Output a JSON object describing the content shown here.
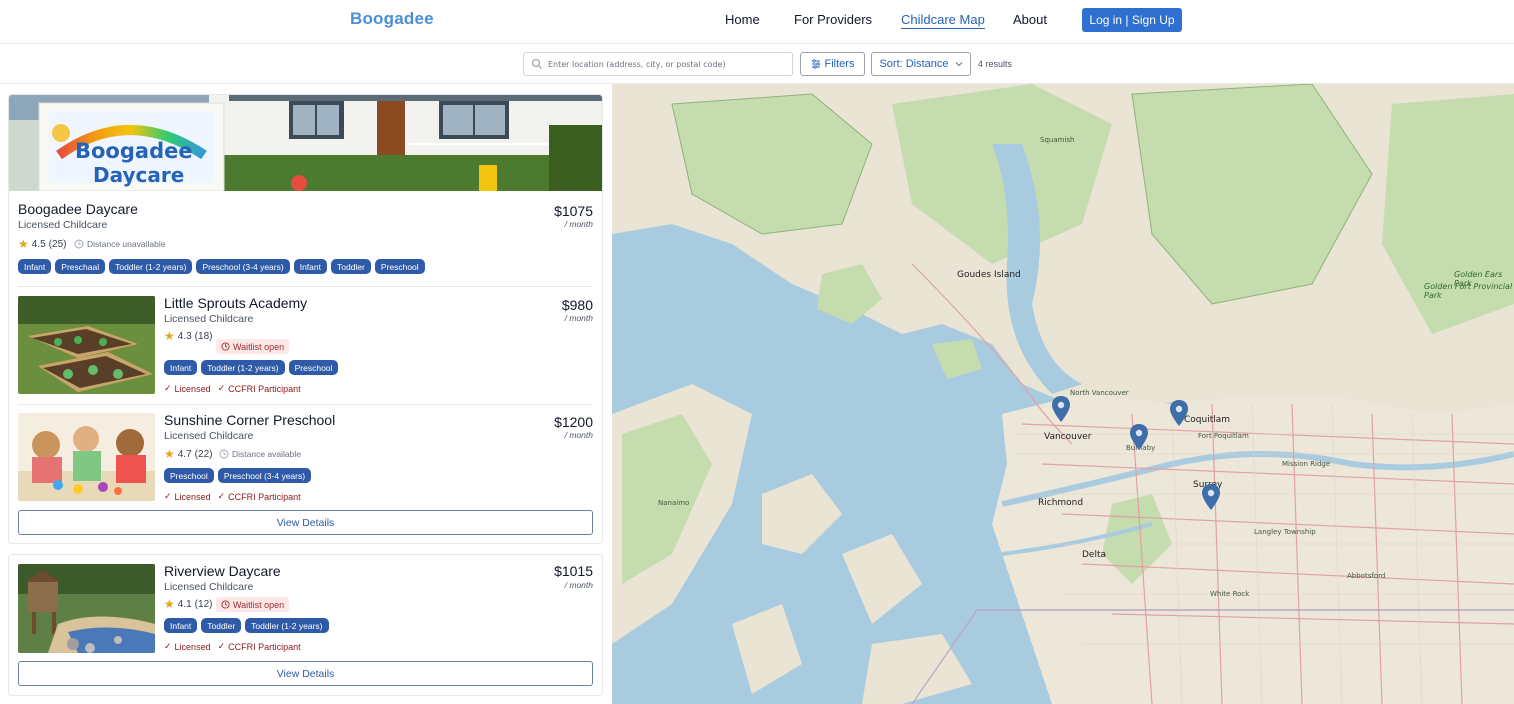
{
  "nav": {
    "logo": "Boogadee",
    "links": [
      "Home",
      "For Providers",
      "Childcare Map",
      "About"
    ],
    "active": "Childcare Map",
    "login": "Log in | Sign Up"
  },
  "search": {
    "placeholder": "Enter location (address, city, or postal code)",
    "filters_label": "Filters",
    "sort_label": "Sort: Distance",
    "results": "4 results"
  },
  "listings": [
    {
      "name": "Boogadee Daycare",
      "type": "Licensed Childcare",
      "price": "$1075",
      "per": "/ month",
      "rating": "4.5",
      "reviews": "(25)",
      "distance": "Distance unavailable",
      "chips": [
        "Infant",
        "Preschaal",
        "Toddler (1-2 years)",
        "Preschool (3-4 years)",
        "Infant",
        "Toddler",
        "Preschool"
      ],
      "hero_sign": [
        "Boogadee",
        "Daycare"
      ]
    },
    {
      "name": "Little Sprouts Academy",
      "type": "Licensed Childcare",
      "price": "$980",
      "per": "/ month",
      "rating": "4.3",
      "reviews": "(18)",
      "status": "Waitlist open",
      "chips": [
        "Infant",
        "Toddler (1-2 years)",
        "Preschool"
      ],
      "checks": [
        "Licensed",
        "CCFRI Participant"
      ]
    },
    {
      "name": "Sunshine Corner Preschool",
      "type": "Licensed Childcare",
      "price": "$1200",
      "per": "/ month",
      "rating": "4.7",
      "reviews": "(22)",
      "distance": "Distance available",
      "chips": [
        "Preschool",
        "Preschool (3-4 years)"
      ],
      "checks": [
        "Licensed",
        "CCFRI Participant"
      ]
    },
    {
      "name": "Riverview Daycare",
      "type": "Licensed Childcare",
      "price": "$1015",
      "per": "/ month",
      "rating": "4.1",
      "reviews": "(12)",
      "status": "Waitlist open",
      "chips": [
        "Infant",
        "Toddler",
        "Toddler (1-2 years)"
      ],
      "checks": [
        "Licensed",
        "CCFRI Participant"
      ]
    }
  ],
  "view_details": "View Details",
  "map": {
    "labels": [
      "Squamish",
      "Golden Ears Park",
      "Golden Fort Provincial Park",
      "Goudes Island",
      "North Vancouver",
      "Vancouver",
      "Coquitlam",
      "Fort Poquitlam",
      "Burnaby",
      "Richmond",
      "Surrey",
      "Mission Ridge",
      "Nanaimo",
      "Delta",
      "White Rock",
      "Langley Township",
      "Abbotsford"
    ],
    "water_color": "#a9cbe0",
    "land_color": "#e9e4d4",
    "park_color": "#c4dcae",
    "pin_color": "#3f6fa8"
  }
}
